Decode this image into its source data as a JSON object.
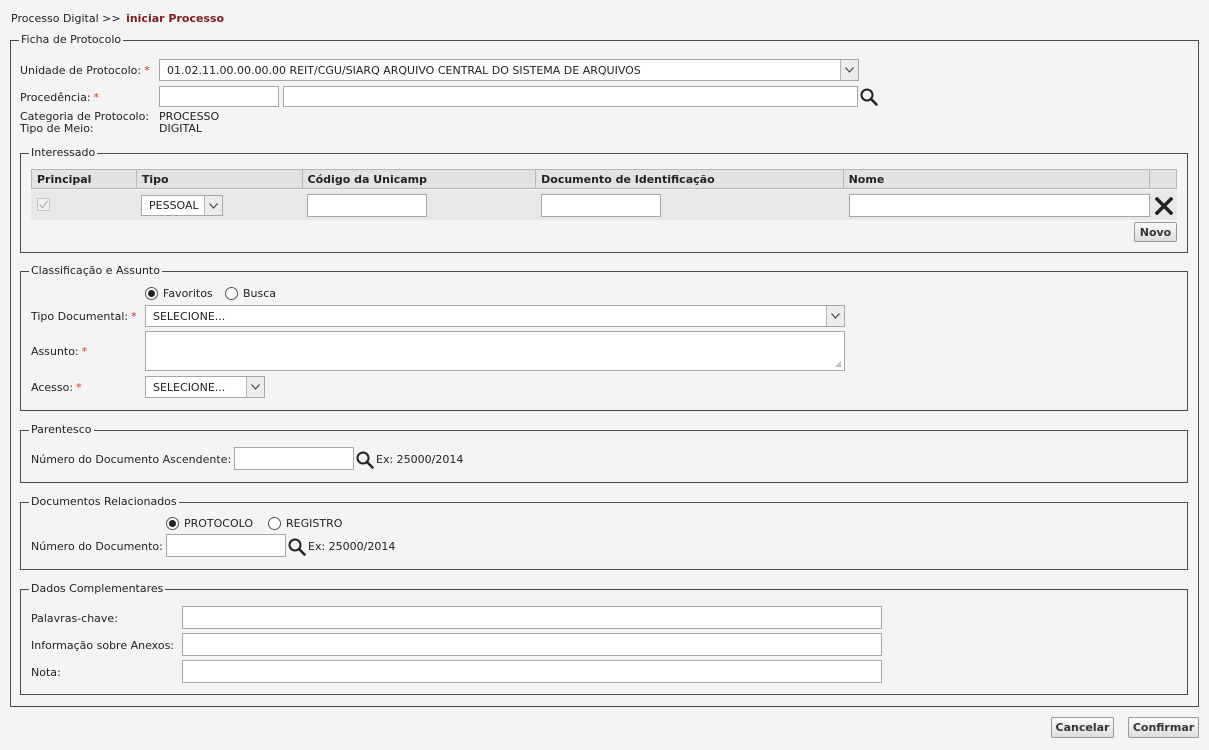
{
  "breadcrumb": {
    "root": "Processo Digital >>",
    "current": "iniciar Processo"
  },
  "ficha": {
    "legend": "Ficha de Protocolo",
    "unidade_label": "Unidade de Protocolo:",
    "unidade_value": "01.02.11.00.00.00.00 REIT/CGU/SIARQ ARQUIVO CENTRAL DO SISTEMA DE ARQUIVOS",
    "procedencia_label": "Procedência:",
    "categoria_label": "Categoria de Protocolo:",
    "categoria_value": "PROCESSO",
    "meio_label": "Tipo de Meio:",
    "meio_value": "DIGITAL",
    "required_mark": "*"
  },
  "interessado": {
    "legend": "Interessado",
    "columns": [
      "Principal",
      "Tipo",
      "Código da Unicamp",
      "Documento de Identificação",
      "Nome"
    ],
    "row": {
      "tipo": "PESSOAL",
      "principal_checked": true
    },
    "novo_label": "Novo"
  },
  "classificacao": {
    "legend": "Classificação e Assunto",
    "radio_favoritos": "Favoritos",
    "radio_busca": "Busca",
    "tipo_doc_label": "Tipo Documental:",
    "tipo_doc_value": "SELECIONE...",
    "assunto_label": "Assunto:",
    "acesso_label": "Acesso:",
    "acesso_value": "SELECIONE..."
  },
  "parentesco": {
    "legend": "Parentesco",
    "numero_label": "Número do Documento Ascendente:",
    "example": "Ex: 25000/2014"
  },
  "relacionados": {
    "legend": "Documentos Relacionados",
    "radio_protocolo": "PROTOCOLO",
    "radio_registro": "REGISTRO",
    "numero_label": "Número do Documento:",
    "example": "Ex: 25000/2014"
  },
  "complementares": {
    "legend": "Dados Complementares",
    "palavras_label": "Palavras-chave:",
    "anexos_label": "Informação sobre Anexos:",
    "nota_label": "Nota:"
  },
  "footer": {
    "cancelar": "Cancelar",
    "confirmar": "Confirmar"
  }
}
